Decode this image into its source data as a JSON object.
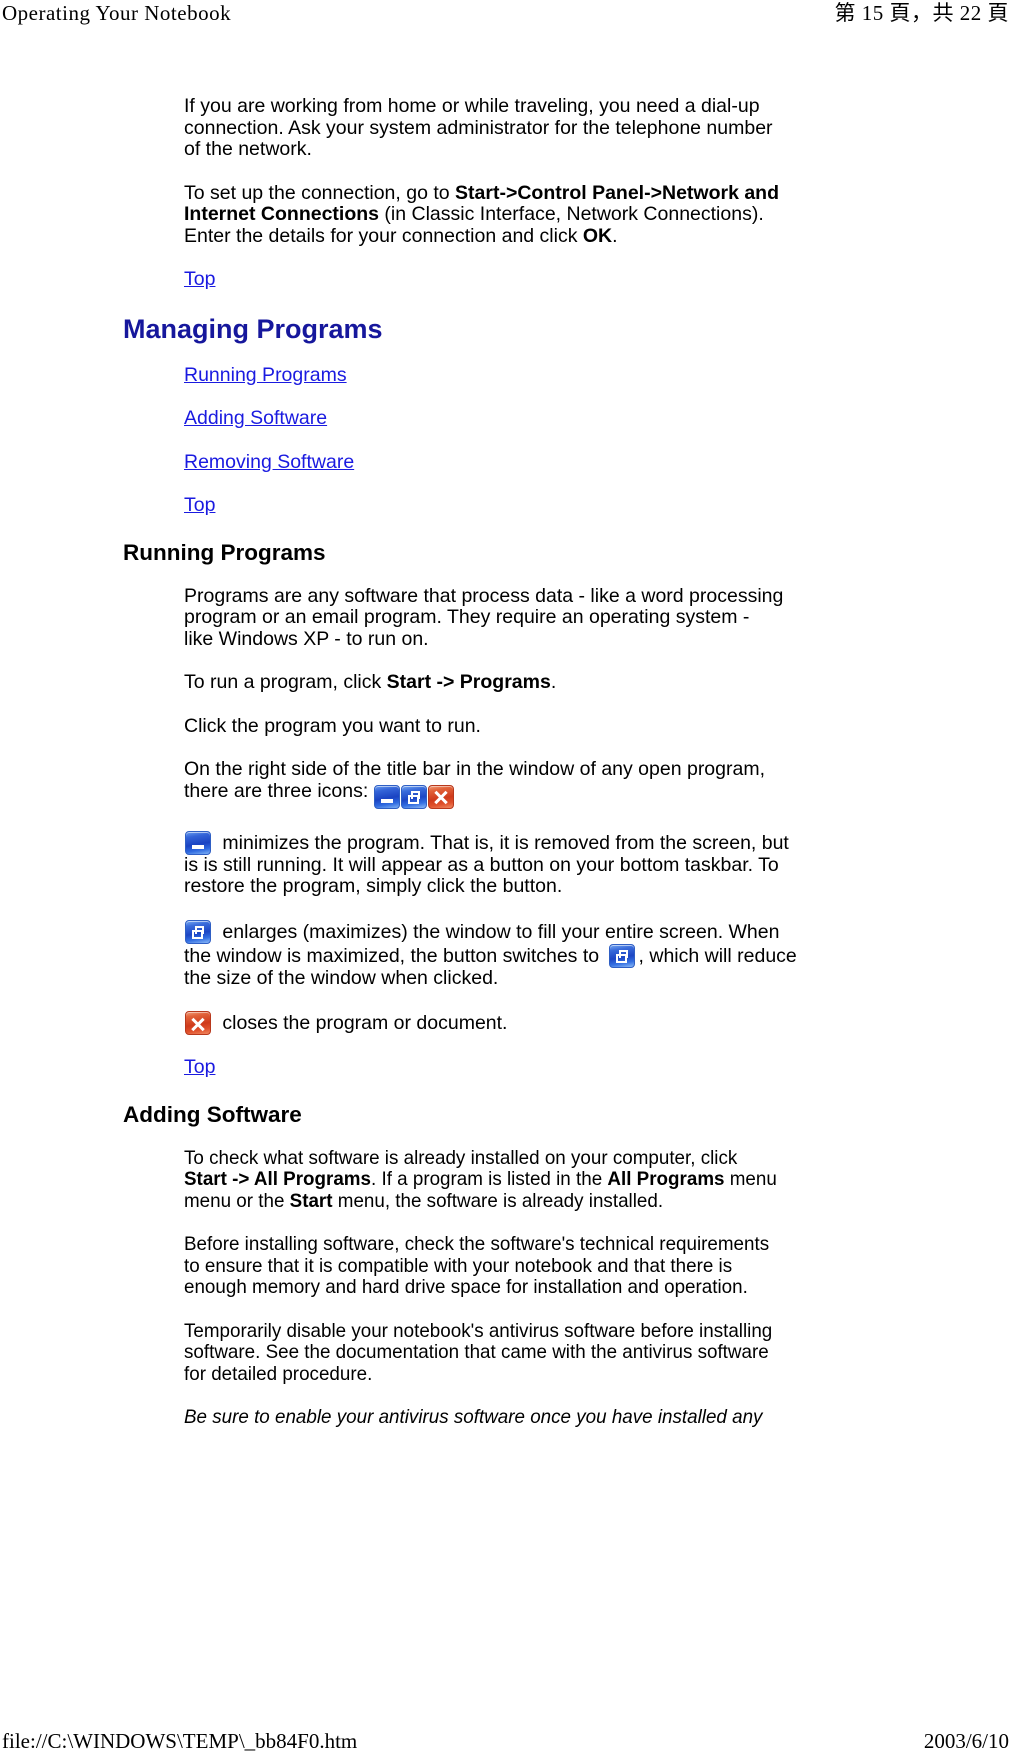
{
  "page": {
    "header_left": "Operating Your Notebook",
    "header_right": "第 15 頁，共 22 頁",
    "footer_left": "file://C:\\WINDOWS\\TEMP\\_bb84F0.htm",
    "footer_right": "2003/6/10"
  },
  "colors": {
    "heading_blue": "#16179c",
    "link_blue": "#1a1ae0",
    "minimize_button": "#1a43c2",
    "maximize_button": "#1d46c4",
    "close_button": "#cf3a1b"
  },
  "intro": {
    "para_dialup": "If you are working from home or while traveling, you need a dial-up connection. Ask your system administrator for the telephone number of the network.",
    "setup_part1": "To set up the connection, go to ",
    "setup_bold1": "Start->Control Panel->Network and Internet Connections",
    "setup_part2": " (in Classic Interface, Network Connections). Enter the details for your connection and click ",
    "setup_bold2": "OK",
    "setup_part3": ".",
    "top_link": "Top"
  },
  "managing": {
    "heading": "Managing Programs",
    "links": [
      "Running Programs",
      "Adding Software",
      "Removing Software"
    ],
    "top_link": "Top"
  },
  "running_programs": {
    "heading": "Running Programs",
    "para_definition": "Programs are any software that process data - like a word processing program or an email program. They require an operating system - like Windows XP - to run on.",
    "run_part1": "To run a program, click ",
    "run_bold": "Start -> Programs",
    "run_part2": ".",
    "para_click": "Click the program you want to run.",
    "titlebar_part1": "On the right side of the title bar in the window of any open program, there are three icons: ",
    "minimize_text": " minimizes the program. That is, it is removed from the screen, but is is still running. It will appear as a button on your bottom taskbar. To restore the program, simply click the button.",
    "maximize_part1": " enlarges (maximizes) the window to fill your entire screen. When the window is maximized, the button switches to ",
    "maximize_part2": ", which will reduce the size of the window when clicked.",
    "close_text": " closes the program or document.",
    "top_link": "Top"
  },
  "adding_software": {
    "heading": "Adding Software",
    "check_part1": "To check what software is already installed on your computer, click ",
    "check_bold1": "Start -> All Programs",
    "check_part2": ". If a program is listed in the ",
    "check_bold2": "All Programs",
    "check_part3": " menu menu or the ",
    "check_bold3": "Start",
    "check_part4": " menu, the software is already installed.",
    "para_before": "Before installing software, check the software's technical requirements to ensure that it is compatible with your notebook and that there is enough memory and hard drive space for installation and operation.",
    "para_antivirus": "Temporarily disable your notebook's antivirus software before installing software. See the documentation that came with the antivirus software for detailed procedure.",
    "para_italic": "Be sure to enable your antivirus software once you have installed any"
  },
  "icons": {
    "minimize": "window-minimize-icon",
    "maximize": "window-maximize-icon",
    "restore": "window-restore-icon",
    "close": "window-close-icon"
  }
}
